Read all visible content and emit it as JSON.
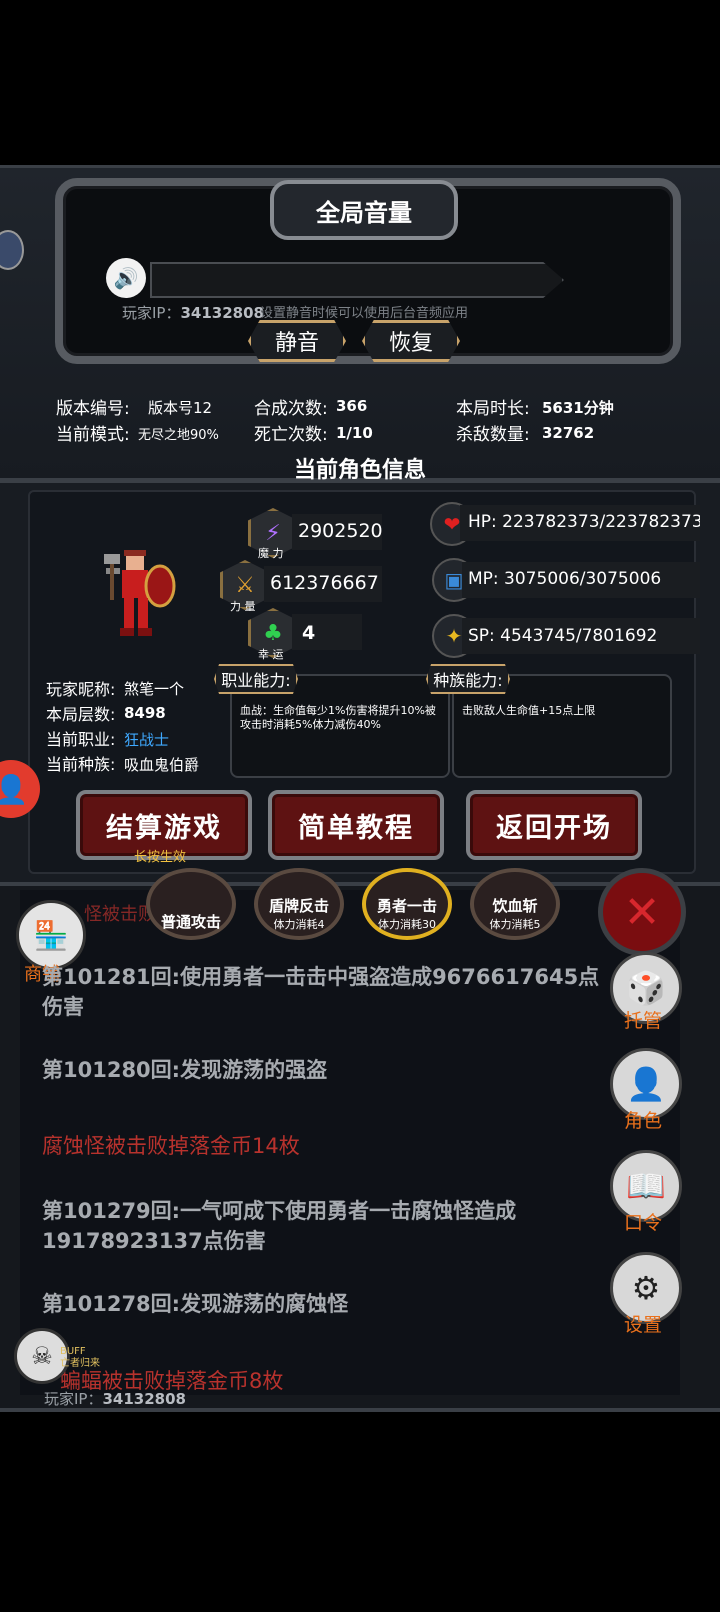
{
  "volume_panel": {
    "title": "全局音量",
    "player_ip_label": "玩家IP：",
    "player_ip": "34132808",
    "mute_hint": "设置静音时候可以使用后台音频应用",
    "mute_button": "静音",
    "restore_button": "恢复"
  },
  "stats": {
    "version_label": "版本编号:",
    "version_value": "版本号12",
    "mode_label": "当前模式:",
    "mode_value": "无尽之地90%",
    "synth_label": "合成次数:",
    "synth_value": "366",
    "death_label": "死亡次数:",
    "death_value": "1/10",
    "time_label": "本局时长:",
    "time_value": "5631分钟",
    "kills_label": "杀敌数量:",
    "kills_value": "32762"
  },
  "character": {
    "section_title": "当前角色信息",
    "magic_label": "魔 力",
    "magic_value": "2902520",
    "strength_label": "力 量",
    "strength_value": "612376667",
    "luck_label": "幸 运",
    "luck_value": "4",
    "hp_text": "HP:  223782373/223782373",
    "mp_text": "MP:  3075006/3075006",
    "sp_text": "SP:  4543745/7801692",
    "nickname_label": "玩家昵称:",
    "nickname_value": "煞笔一个",
    "floor_label": "本局层数:",
    "floor_value": "8498",
    "job_label": "当前职业:",
    "job_value": "狂战士",
    "race_label": "当前种族:",
    "race_value": "吸血鬼伯爵",
    "job_ability_label": "职业能力:",
    "job_ability_text": "血战：生命值每少1%伤害将提升10%被攻击时消耗5%体力减伤40%",
    "race_ability_label": "种族能力:",
    "race_ability_text": "击败敌人生命值+15点上限"
  },
  "actions": {
    "settle_button": "结算游戏",
    "settle_hint": "长按生效",
    "tutorial_button": "简单教程",
    "return_button": "返回开场"
  },
  "skills": [
    {
      "name": "普通攻击",
      "cost": ""
    },
    {
      "name": "盾牌反击",
      "cost": "体力消耗4"
    },
    {
      "name": "勇者一击",
      "cost": "体力消耗30"
    },
    {
      "name": "饮血斩",
      "cost": "体力消耗5"
    }
  ],
  "log": {
    "partial_top": "怪被击败掉落金币",
    "entries": [
      "第101281回:使用勇者一击击中强盗造成9676617645点伤害",
      "第101280回:发现游荡的强盗",
      "腐蚀怪被击败掉落金币14枚",
      "第101279回:一气呵成下使用勇者一击腐蚀怪造成19178923137点伤害",
      "第101278回:发现游荡的腐蚀怪",
      "蝙蝠被击败掉落金币8枚"
    ]
  },
  "side_menu": {
    "shop": "商铺",
    "auto": "托管",
    "role": "角色",
    "code": "口令",
    "settings": "设置"
  },
  "buff": {
    "title": "BUFF",
    "name": "亡者归来"
  },
  "bottom_ip_label": "玩家IP：",
  "bottom_ip": "34132808",
  "colors": {
    "accent_gold": "#c8a36a",
    "log_red": "#b8322d",
    "side_orange": "#e8701c",
    "job_blue": "#3fa9ff"
  }
}
